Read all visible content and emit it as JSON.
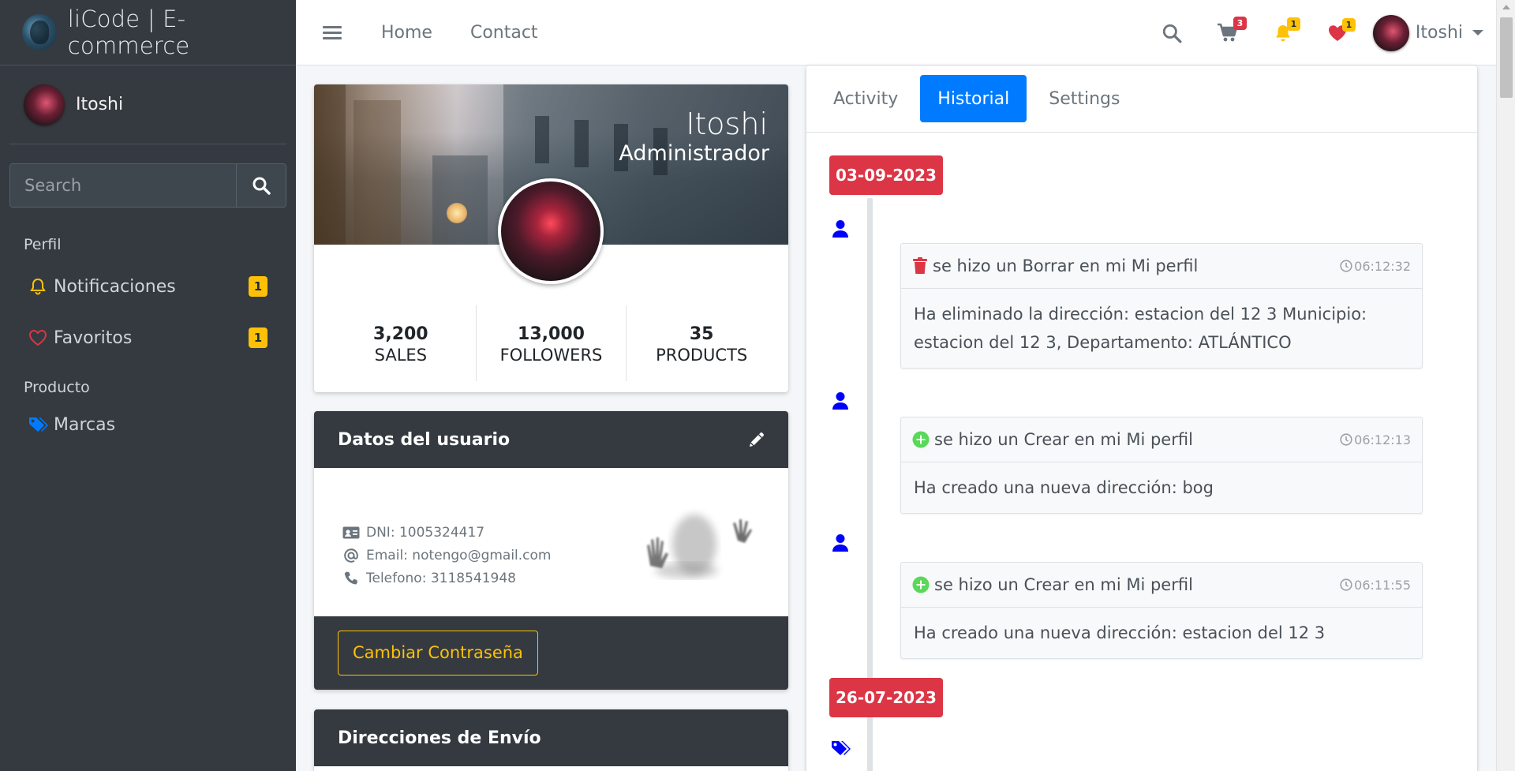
{
  "brand": {
    "name": "liCode | E-commerce"
  },
  "sidebar": {
    "user_name": "Itoshi",
    "search_placeholder": "Search",
    "sections": [
      {
        "header": "Perfil"
      },
      {
        "header": "Producto"
      }
    ],
    "items": [
      {
        "label": "Notificaciones",
        "badge": "1",
        "icon": "bell-icon"
      },
      {
        "label": "Favoritos",
        "badge": "1",
        "icon": "heart-icon"
      },
      {
        "label": "Marcas",
        "icon": "tags-icon"
      }
    ]
  },
  "navbar": {
    "links": [
      "Home",
      "Contact"
    ],
    "cart_badge": "3",
    "bell_badge": "1",
    "heart_badge": "1",
    "user_name": "Itoshi"
  },
  "profile": {
    "name": "Itoshi",
    "role": "Administrador",
    "stats": [
      {
        "value": "3,200",
        "label": "SALES"
      },
      {
        "value": "13,000",
        "label": "FOLLOWERS"
      },
      {
        "value": "35",
        "label": "PRODUCTS"
      }
    ]
  },
  "user_data": {
    "title": "Datos del usuario",
    "dni": "DNI: 1005324417",
    "email": "Email: notengo@gmail.com",
    "phone": "Telefono: 3118541948",
    "change_password": "Cambiar Contraseña"
  },
  "addresses": {
    "title": "Direcciones de Envío"
  },
  "tabs": [
    "Activity",
    "Historial",
    "Settings"
  ],
  "active_tab": "Historial",
  "timeline": {
    "dates": [
      "03-09-2023",
      "26-07-2023"
    ],
    "items": [
      {
        "action": "Borrar",
        "title": "se hizo un Borrar en mi Mi perfil",
        "time": "06:12:32",
        "body": "Ha eliminado la dirección: estacion del 12 3 Municipio: estacion del 12 3, Departamento: ATLÁNTICO"
      },
      {
        "action": "Crear",
        "title": "se hizo un Crear en mi Mi perfil",
        "time": "06:12:13",
        "body": "Ha creado una nueva dirección: bog"
      },
      {
        "action": "Crear",
        "title": "se hizo un Crear en mi Mi perfil",
        "time": "06:11:55",
        "body": "Ha creado una nueva dirección: estacion del 12 3"
      }
    ]
  },
  "colors": {
    "sidebar_bg": "#343a40",
    "primary": "#007bff",
    "danger": "#dc3545",
    "warning": "#ffc107",
    "success": "#5ad85a"
  }
}
